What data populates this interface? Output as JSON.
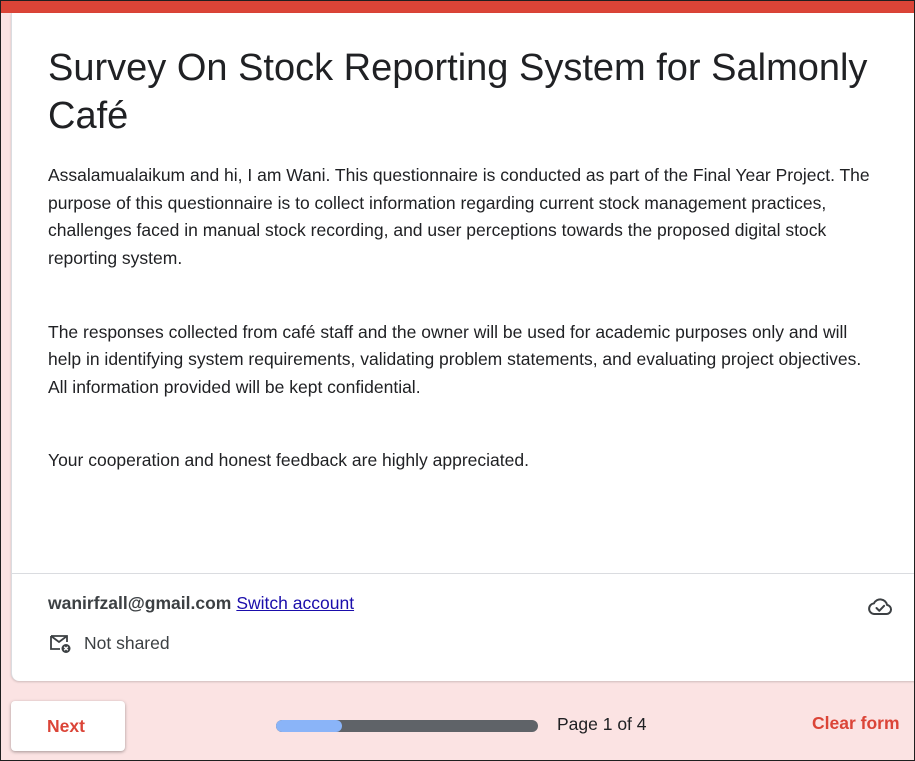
{
  "form": {
    "title": "Survey On Stock Reporting System for Salmonly Café",
    "description": [
      "Assalamualaikum and hi, I am Wani. This questionnaire is conducted as part of the Final Year Project. The purpose of this questionnaire is to collect information regarding current stock management practices, challenges faced in manual stock recording, and user perceptions towards the proposed digital stock reporting system.",
      "The responses collected from café staff and the owner will be used for academic purposes only and will help in identifying system requirements, validating problem statements, and evaluating project objectives. All information provided will be kept confidential.",
      "Your cooperation and honest feedback are highly appreciated."
    ],
    "accent_color": "#db4437",
    "background_color": "#fbe3e3"
  },
  "account": {
    "email": "wanirfzall@gmail.com",
    "switch_label": "Switch account",
    "shared_status": "Not shared",
    "shared_icon": "mail-not-shared-icon",
    "save_status_icon": "cloud-saved-icon"
  },
  "footer": {
    "next_label": "Next",
    "page_label": "Page 1 of 4",
    "progress_fraction": 0.25,
    "clear_label": "Clear form",
    "progress_fill_color": "#8ab4f8",
    "progress_track_color": "#5f6368"
  }
}
